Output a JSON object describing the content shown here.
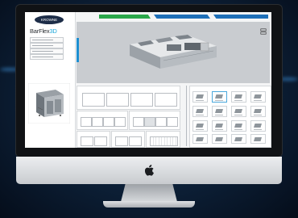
{
  "app": {
    "brand": "KROWNE",
    "product_name": "BarFlex",
    "product_suffix": "3D"
  },
  "tabs": [
    {
      "label": "",
      "color": "#2aa84a"
    },
    {
      "label": "",
      "color": "#1d6fb8"
    },
    {
      "label": "",
      "color": "#1d6fb8"
    }
  ],
  "colors": {
    "accent": "#1aa6d9",
    "brand_navy": "#1d2d48",
    "viewer_bg": "#c9ccd0"
  },
  "icons": [
    "apple-logo-icon",
    "view-controls-icon"
  ]
}
